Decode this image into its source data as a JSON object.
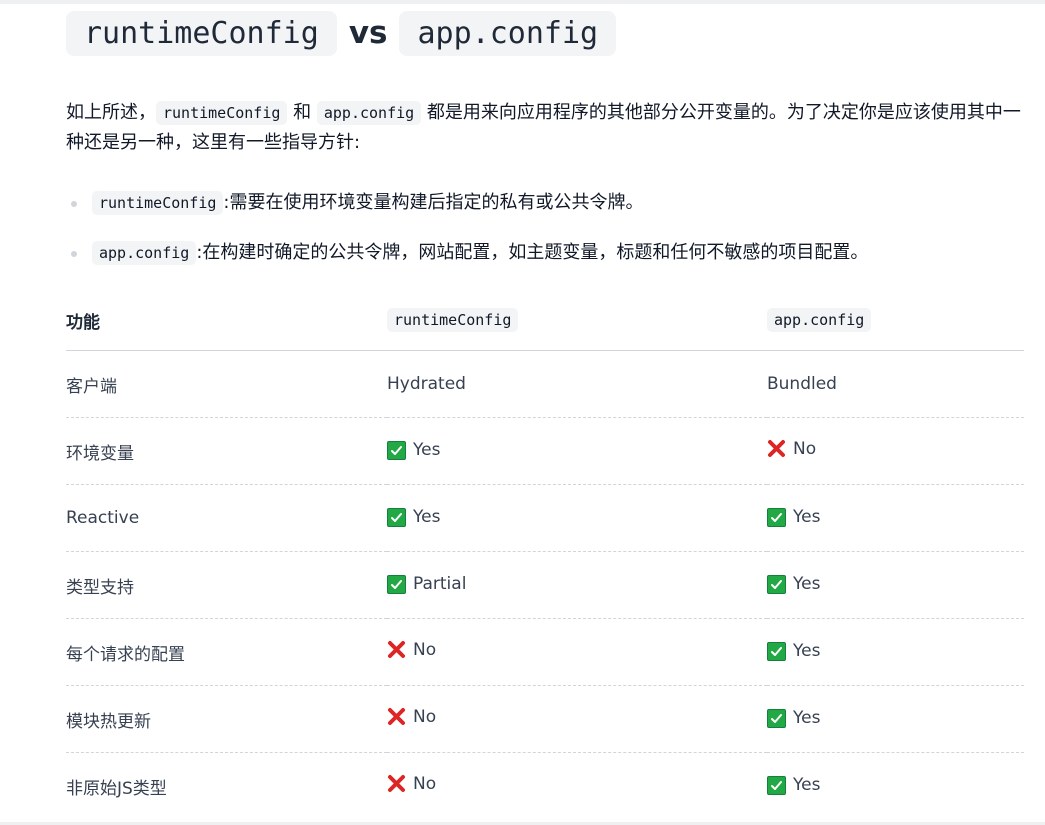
{
  "title": {
    "left_code": "runtimeConfig",
    "vs": "vs",
    "right_code": "app.config"
  },
  "intro": {
    "prefix": "如上所述，",
    "code1": "runtimeConfig",
    "and": " 和 ",
    "code2": "app.config",
    "rest": " 都是用来向应用程序的其他部分公开变量的。为了决定你是应该使用其中一种还是另一种，这里有一些指导方针:"
  },
  "bullets": [
    {
      "code": "runtimeConfig",
      "text": ":需要在使用环境变量构建后指定的私有或公共令牌。"
    },
    {
      "code": "app.config",
      "text": ":在构建时确定的公共令牌，网站配置，如主题变量，标题和任何不敏感的项目配置。"
    }
  ],
  "table": {
    "headers": {
      "feature": "功能",
      "runtime": "runtimeConfig",
      "app": "app.config"
    },
    "rows": [
      {
        "feature": "客户端",
        "runtime": {
          "text": "Hydrated",
          "icon": ""
        },
        "app": {
          "text": "Bundled",
          "icon": ""
        }
      },
      {
        "feature": "环境变量",
        "runtime": {
          "text": "Yes",
          "icon": "check-icon"
        },
        "app": {
          "text": "No",
          "icon": "cross-icon"
        }
      },
      {
        "feature": "Reactive",
        "runtime": {
          "text": "Yes",
          "icon": "check-icon"
        },
        "app": {
          "text": "Yes",
          "icon": "check-icon"
        }
      },
      {
        "feature": "类型支持",
        "runtime": {
          "text": "Partial",
          "icon": "check-icon"
        },
        "app": {
          "text": "Yes",
          "icon": "check-icon"
        }
      },
      {
        "feature": "每个请求的配置",
        "runtime": {
          "text": "No",
          "icon": "cross-icon"
        },
        "app": {
          "text": "Yes",
          "icon": "check-icon"
        }
      },
      {
        "feature": "模块热更新",
        "runtime": {
          "text": "No",
          "icon": "cross-icon"
        },
        "app": {
          "text": "Yes",
          "icon": "check-icon"
        }
      },
      {
        "feature": "非原始JS类型",
        "runtime": {
          "text": "No",
          "icon": "cross-icon"
        },
        "app": {
          "text": "Yes",
          "icon": "check-icon"
        }
      }
    ]
  },
  "colors": {
    "check_green": "#22a845",
    "cross_red": "#dc2626",
    "code_bg": "#f3f4f6"
  }
}
